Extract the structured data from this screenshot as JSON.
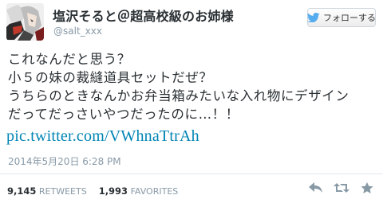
{
  "user": {
    "display_name": "塩沢そると＠超高校級のお姉様",
    "handle": "@salt_xxx"
  },
  "follow_button": {
    "label": "フォローする",
    "icon": "twitter-bird-icon"
  },
  "tweet": {
    "lines": [
      "これなんだと思う？",
      "小５の妹の裁縫道具セットだぜ？",
      "うちらのときなんかお弁当箱みたいな入れ物にデザイン",
      "だってだっさいやつだったのに…！！"
    ],
    "link": "pic.twitter.com/VWhnaTtrAh",
    "timestamp": "2014年5月20日 6:28 PM"
  },
  "stats": {
    "retweets_count": "9,145",
    "retweets_label": "RETWEETS",
    "favorites_count": "1,993",
    "favorites_label": "FAVORITES"
  },
  "actions": {
    "reply_icon": "reply-icon",
    "retweet_icon": "retweet-icon",
    "favorite_icon": "star-icon"
  },
  "colors": {
    "link": "#0084b4",
    "muted": "#8899a6",
    "text": "#292f33",
    "twitter_blue": "#55acee"
  }
}
